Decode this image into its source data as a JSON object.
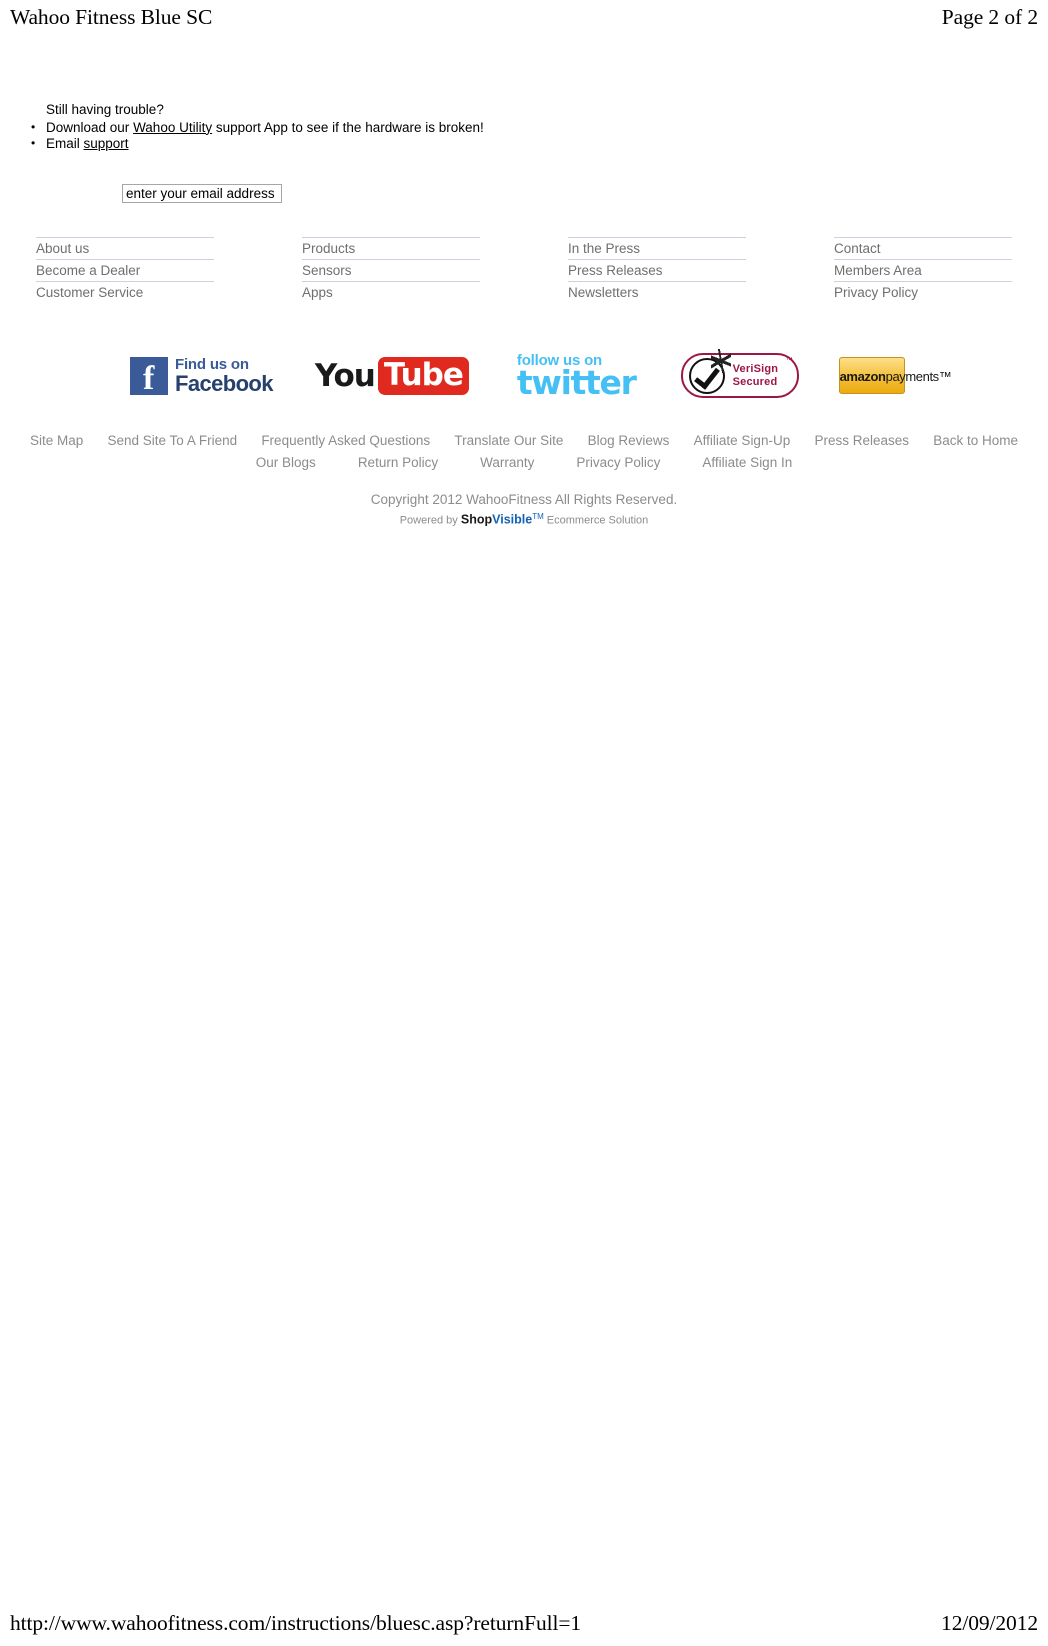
{
  "print_header": {
    "title": "Wahoo Fitness Blue SC",
    "page_indicator": "Page 2 of 2"
  },
  "trouble": {
    "heading": "Still having trouble?",
    "bullet1_pre": "Download our ",
    "bullet1_link": "Wahoo Utility",
    "bullet1_post": " support App to see if the hardware is broken!",
    "bullet2_pre": "Email ",
    "bullet2_link": "support"
  },
  "email_signup": {
    "value": "enter your email address",
    "placeholder": "enter your email address"
  },
  "footer_columns": [
    {
      "items": [
        "About us",
        "Become a Dealer",
        "Customer Service"
      ]
    },
    {
      "items": [
        "Products",
        "Sensors",
        "Apps"
      ]
    },
    {
      "items": [
        "In the Press",
        "Press Releases",
        "Newsletters"
      ]
    },
    {
      "items": [
        "Contact",
        "Members Area",
        "Privacy Policy"
      ]
    }
  ],
  "badges": {
    "facebook": {
      "line1": "Find us on",
      "line2": "Facebook",
      "mark": "f"
    },
    "youtube": {
      "part1": "You",
      "part2": "Tube"
    },
    "twitter": {
      "line1": "follow us on",
      "line2": "twitter"
    },
    "verisign": {
      "line1": "VeriSign",
      "line2": "Secured",
      "tm": "™"
    },
    "amazon": {
      "line1": "amazon",
      "line2": "payments™"
    }
  },
  "bottom_links_row1": [
    "Site Map",
    "Send Site To A Friend",
    "Frequently Asked Questions",
    "Translate Our Site",
    "Blog Reviews",
    "Affiliate Sign-Up",
    "Press Releases",
    "Back to Home"
  ],
  "bottom_links_row2": [
    "Our Blogs",
    "Return Policy",
    "Warranty",
    "Privacy Policy",
    "Affiliate Sign In"
  ],
  "copyright": {
    "text": "Copyright 2012 WahooFitness All Rights Reserved.",
    "powered_pre": "Powered by ",
    "powered_shop": "Shop",
    "powered_visible": "Visible",
    "powered_tm": "TM",
    "powered_post": " Ecommerce Solution"
  },
  "print_footer": {
    "url": "http://www.wahoofitness.com/instructions/bluesc.asp?returnFull=1",
    "date": "12/09/2012"
  },
  "colors": {
    "facebook_blue": "#3a5a98",
    "youtube_red": "#e02a20",
    "twitter_blue": "#45c0f5",
    "verisign_maroon": "#9c1648",
    "amazon_gold": "#f3bc32",
    "muted_text": "#8c8c8c",
    "rule": "#c9d2dd"
  }
}
